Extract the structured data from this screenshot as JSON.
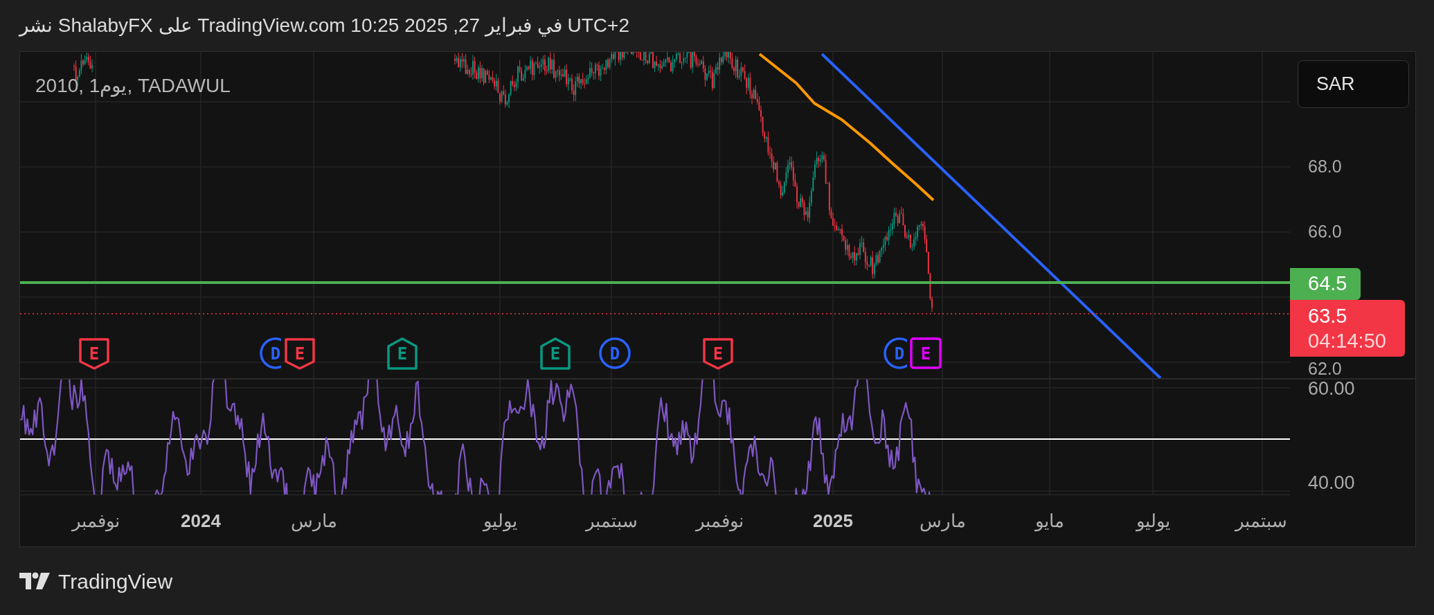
{
  "header": {
    "text": "نشر ShalabyFX على TradingView.com في فبراير 27, 2025 10:25 UTC+2"
  },
  "symbol": "2010, 1يوم, TADAWUL",
  "currency_button": "SAR",
  "price_axis": {
    "ticks": [
      "68.0",
      "66.0",
      "62.0"
    ]
  },
  "price_tags": [
    {
      "label": "64.5",
      "kind": "line"
    },
    {
      "label": "63.5",
      "countdown": "04:14:50",
      "kind": "last"
    }
  ],
  "markers": [
    {
      "label": "E",
      "kind": "square",
      "color": "#e100ff"
    },
    {
      "label": "D",
      "kind": "circle",
      "color": "#2962ff"
    },
    {
      "label": "E",
      "kind": "down",
      "color": "#f23645"
    },
    {
      "label": "D",
      "kind": "circle",
      "color": "#2962ff"
    },
    {
      "label": "E",
      "kind": "up",
      "color": "#089981"
    },
    {
      "label": "E",
      "kind": "up",
      "color": "#089981"
    },
    {
      "label": "E",
      "kind": "down",
      "color": "#f23645"
    },
    {
      "label": "D",
      "kind": "circle",
      "color": "#2962ff"
    },
    {
      "label": "E",
      "kind": "down",
      "color": "#f23645"
    }
  ],
  "rsi_axis": {
    "ticks": [
      "60.00",
      "40.00"
    ]
  },
  "time_axis": [
    {
      "label": "سبتمبر",
      "kind": "month"
    },
    {
      "label": "يوليو",
      "kind": "month"
    },
    {
      "label": "مايو",
      "kind": "month"
    },
    {
      "label": "مارس",
      "kind": "month"
    },
    {
      "label": "2025",
      "kind": "year"
    },
    {
      "label": "نوفمبر",
      "kind": "month"
    },
    {
      "label": "سبتمبر",
      "kind": "month"
    },
    {
      "label": "يوليو",
      "kind": "month"
    },
    {
      "label": "مارس",
      "kind": "month"
    },
    {
      "label": "2024",
      "kind": "year"
    },
    {
      "label": "نوفمبر",
      "kind": "month"
    }
  ],
  "footer": {
    "brand": "TradingView"
  }
}
